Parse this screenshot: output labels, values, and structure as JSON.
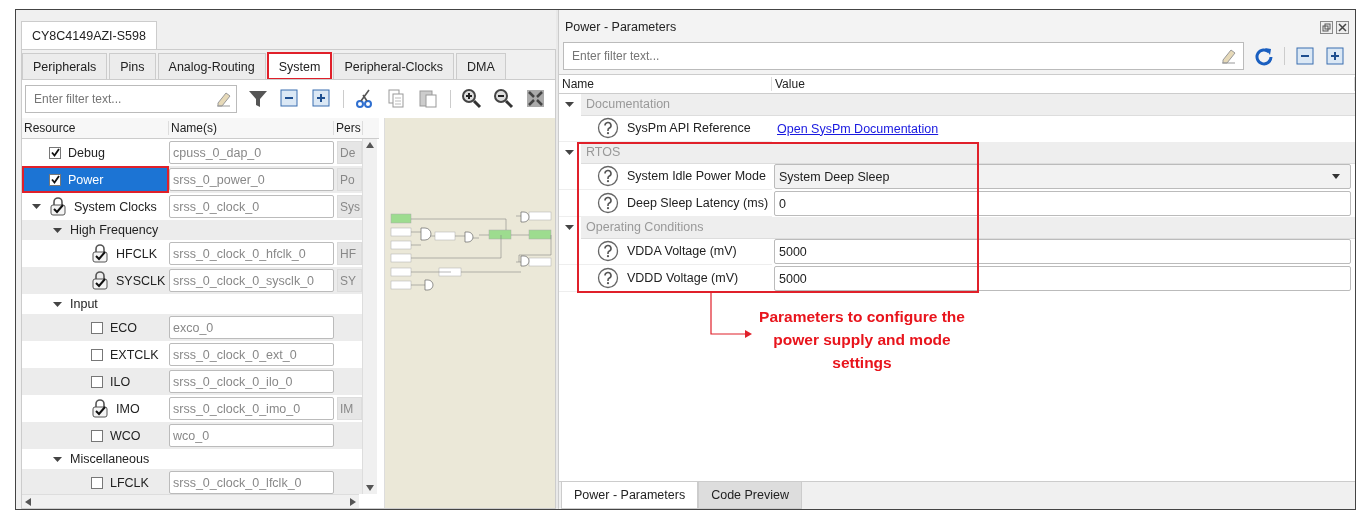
{
  "device_tab": {
    "label": "CY8C4149AZI-S598"
  },
  "tabs": [
    {
      "label": "Peripherals",
      "selected": false,
      "highlighted": false
    },
    {
      "label": "Pins",
      "selected": false,
      "highlighted": false
    },
    {
      "label": "Analog-Routing",
      "selected": false,
      "highlighted": false
    },
    {
      "label": "System",
      "selected": true,
      "highlighted": true
    },
    {
      "label": "Peripheral-Clocks",
      "selected": false,
      "highlighted": false
    },
    {
      "label": "DMA",
      "selected": false,
      "highlighted": false
    }
  ],
  "resource_filter": {
    "placeholder": "Enter filter text..."
  },
  "resource_table": {
    "columns": [
      "Resource",
      "Name(s)",
      "Pers"
    ],
    "rows": [
      {
        "kind": "checkbox",
        "label": "Debug",
        "checked": true,
        "selected": false,
        "highlighted": false,
        "name": "cpuss_0_dap_0",
        "column_3": "De"
      },
      {
        "kind": "checkbox",
        "label": "Power",
        "checked": true,
        "selected": true,
        "highlighted": true,
        "name": "srss_0_power_0",
        "column_3": "Po"
      },
      {
        "kind": "locked",
        "label": "System Clocks",
        "expanded": true,
        "selected": false,
        "highlighted": false,
        "name": "srss_0_clock_0",
        "column_3": "Sys",
        "children": [
          {
            "kind": "group",
            "label": "High Frequency",
            "expanded": true,
            "selected": false,
            "highlighted": false,
            "children": [
              {
                "kind": "locked",
                "label": "HFCLK",
                "selected": false,
                "highlighted": false,
                "name": "srss_0_clock_0_hfclk_0",
                "column_3": "HF"
              },
              {
                "kind": "locked",
                "label": "SYSCLK",
                "selected": false,
                "highlighted": false,
                "name": "srss_0_clock_0_sysclk_0",
                "column_3": "SY"
              }
            ]
          },
          {
            "kind": "group",
            "label": "Input",
            "expanded": true,
            "selected": false,
            "highlighted": false,
            "children": [
              {
                "kind": "checkbox",
                "label": "ECO",
                "checked": false,
                "selected": false,
                "highlighted": false,
                "name": "exco_0"
              },
              {
                "kind": "checkbox",
                "label": "EXTCLK",
                "checked": false,
                "selected": false,
                "highlighted": false,
                "name": "srss_0_clock_0_ext_0"
              },
              {
                "kind": "checkbox",
                "label": "ILO",
                "checked": false,
                "selected": false,
                "highlighted": false,
                "name": "srss_0_clock_0_ilo_0"
              },
              {
                "kind": "locked",
                "label": "IMO",
                "selected": false,
                "highlighted": false,
                "name": "srss_0_clock_0_imo_0",
                "column_3": "IM"
              },
              {
                "kind": "checkbox",
                "label": "WCO",
                "checked": false,
                "selected": false,
                "highlighted": false,
                "name": "wco_0"
              }
            ]
          },
          {
            "kind": "group",
            "label": "Miscellaneous",
            "expanded": true,
            "selected": false,
            "highlighted": false,
            "children": [
              {
                "kind": "checkbox",
                "label": "LFCLK",
                "checked": false,
                "selected": false,
                "highlighted": false,
                "name": "srss_0_clock_0_lfclk_0"
              }
            ]
          }
        ]
      }
    ]
  },
  "parameters": {
    "title": "Power - Parameters",
    "filter": {
      "placeholder": "Enter filter text..."
    },
    "columns": [
      "Name",
      "Value"
    ],
    "groups": [
      {
        "label": "Documentation",
        "expanded": true,
        "highlighted": false,
        "items": [
          {
            "kind": "link",
            "name": "SysPm API Reference",
            "value": "Open SysPm Documentation"
          }
        ]
      },
      {
        "label": "RTOS",
        "expanded": true,
        "highlighted": true,
        "items": [
          {
            "kind": "dropdown",
            "name": "System Idle Power Mode",
            "value": "System Deep Sleep"
          },
          {
            "kind": "text",
            "name": "Deep Sleep Latency (ms)",
            "value": "0"
          }
        ]
      },
      {
        "label": "Operating Conditions",
        "expanded": true,
        "highlighted": true,
        "items": [
          {
            "kind": "text",
            "name": "VDDA Voltage (mV)",
            "value": "5000"
          },
          {
            "kind": "text",
            "name": "VDDD Voltage (mV)",
            "value": "5000"
          }
        ]
      }
    ],
    "callout": {
      "text": "Parameters to configure the power supply and mode settings"
    }
  },
  "bottom_tabs": [
    {
      "label": "Power - Parameters",
      "selected": true
    },
    {
      "label": "Code Preview",
      "selected": false
    }
  ]
}
